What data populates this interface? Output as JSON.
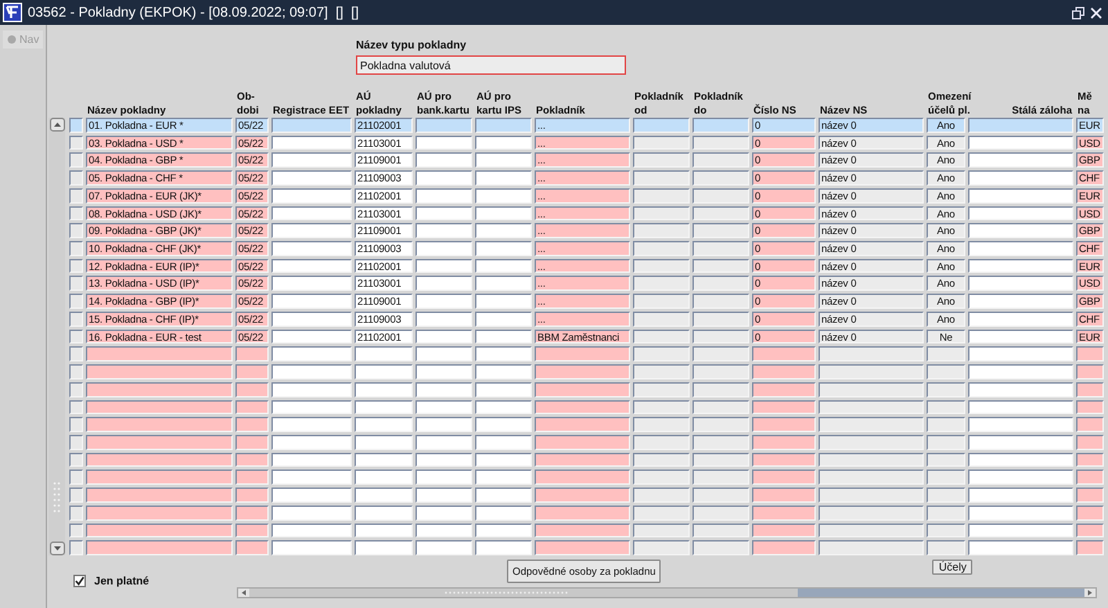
{
  "window": {
    "title": "03562 - Pokladny (EKPOK) - [08.09.2022; 09:07]  []  []"
  },
  "nav_button": {
    "label": "Nav",
    "disabled": true
  },
  "filter": {
    "label": "Název typu pokladny",
    "value": "Pokladna valutová"
  },
  "table": {
    "columns": [
      {
        "label": "Název pokladny",
        "kind": "required"
      },
      {
        "label": "Ob-\ndobi",
        "kind": "required"
      },
      {
        "label": "Registrace EET",
        "kind": "editable"
      },
      {
        "label": "AÚ\npokladny",
        "kind": "editable"
      },
      {
        "label": "AÚ pro\nbank.kartu",
        "kind": "editable"
      },
      {
        "label": "AÚ pro\nkartu IPS",
        "kind": "editable"
      },
      {
        "label": "Pokladník",
        "kind": "required"
      },
      {
        "label": "Pokladník\nod",
        "kind": "readonly"
      },
      {
        "label": "Pokladník\ndo",
        "kind": "readonly"
      },
      {
        "label": "Číslo NS",
        "kind": "required"
      },
      {
        "label": "Název NS",
        "kind": "readonly"
      },
      {
        "label": "Omezení\núčelů pl.",
        "kind": "flag"
      },
      {
        "label": "Stálá záloha",
        "kind": "amount"
      },
      {
        "label": "Mě\nna",
        "kind": "required"
      }
    ],
    "rows": [
      {
        "selected": true,
        "cells": [
          "01. Pokladna - EUR *",
          "05/22",
          null,
          "21102001",
          null,
          null,
          "...",
          null,
          null,
          "0",
          "název 0",
          "Ano",
          null,
          "EUR"
        ]
      },
      {
        "selected": false,
        "cells": [
          "03. Pokladna - USD *",
          "05/22",
          null,
          "21103001",
          null,
          null,
          "...",
          null,
          null,
          "0",
          "název 0",
          "Ano",
          null,
          "USD"
        ]
      },
      {
        "selected": false,
        "cells": [
          "04. Pokladna - GBP *",
          "05/22",
          null,
          "21109001",
          null,
          null,
          "...",
          null,
          null,
          "0",
          "název 0",
          "Ano",
          null,
          "GBP"
        ]
      },
      {
        "selected": false,
        "cells": [
          "05. Pokladna - CHF *",
          "05/22",
          null,
          "21109003",
          null,
          null,
          "...",
          null,
          null,
          "0",
          "název 0",
          "Ano",
          null,
          "CHF"
        ]
      },
      {
        "selected": false,
        "cells": [
          "07. Pokladna - EUR (JK)*",
          "05/22",
          null,
          "21102001",
          null,
          null,
          "...",
          null,
          null,
          "0",
          "název 0",
          "Ano",
          null,
          "EUR"
        ]
      },
      {
        "selected": false,
        "cells": [
          "08. Pokladna - USD (JK)*",
          "05/22",
          null,
          "21103001",
          null,
          null,
          "...",
          null,
          null,
          "0",
          "název 0",
          "Ano",
          null,
          "USD"
        ]
      },
      {
        "selected": false,
        "cells": [
          "09. Pokladna - GBP (JK)*",
          "05/22",
          null,
          "21109001",
          null,
          null,
          "...",
          null,
          null,
          "0",
          "název 0",
          "Ano",
          null,
          "GBP"
        ]
      },
      {
        "selected": false,
        "cells": [
          "10. Pokladna - CHF (JK)*",
          "05/22",
          null,
          "21109003",
          null,
          null,
          "...",
          null,
          null,
          "0",
          "název 0",
          "Ano",
          null,
          "CHF"
        ]
      },
      {
        "selected": false,
        "cells": [
          "12. Pokladna - EUR (IP)*",
          "05/22",
          null,
          "21102001",
          null,
          null,
          "...",
          null,
          null,
          "0",
          "název 0",
          "Ano",
          null,
          "EUR"
        ]
      },
      {
        "selected": false,
        "cells": [
          "13. Pokladna - USD (IP)*",
          "05/22",
          null,
          "21103001",
          null,
          null,
          "...",
          null,
          null,
          "0",
          "název 0",
          "Ano",
          null,
          "USD"
        ]
      },
      {
        "selected": false,
        "cells": [
          "14. Pokladna - GBP (IP)*",
          "05/22",
          null,
          "21109001",
          null,
          null,
          "...",
          null,
          null,
          "0",
          "název 0",
          "Ano",
          null,
          "GBP"
        ]
      },
      {
        "selected": false,
        "cells": [
          "15. Pokladna - CHF (IP)*",
          "05/22",
          null,
          "21109003",
          null,
          null,
          "...",
          null,
          null,
          "0",
          "název 0",
          "Ano",
          null,
          "CHF"
        ]
      },
      {
        "selected": false,
        "cells": [
          "16. Pokladna - EUR - test",
          "05/22",
          null,
          "21102001",
          null,
          null,
          "BBM Zaměstnanci",
          null,
          null,
          "0",
          "název 0",
          "Ne",
          null,
          "EUR"
        ]
      }
    ]
  },
  "footer": {
    "checkbox": {
      "label": "Jen platné",
      "checked": true
    },
    "buttons": [
      "Odpovědné osoby za pokladnu",
      "Účely"
    ]
  }
}
